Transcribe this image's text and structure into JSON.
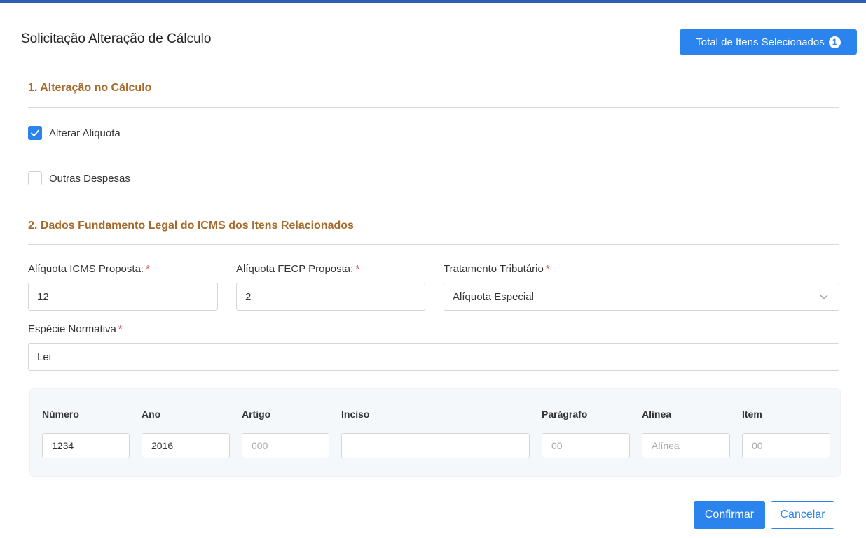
{
  "header": {
    "title": "Solicitação Alteração de Cálculo",
    "total_label": "Total de Itens Selecionados",
    "total_count": "1"
  },
  "section1": {
    "title": "1. Alteração no Cálculo",
    "options": [
      {
        "label": "Alterar Aliquota",
        "checked": true
      },
      {
        "label": "Outras Despesas",
        "checked": false
      }
    ]
  },
  "section2": {
    "title": "2. Dados Fundamento Legal do ICMS dos Itens Relacionados",
    "aliquota_icms": {
      "label": "Alíquota ICMS Proposta:",
      "value": "12"
    },
    "aliquota_fecp": {
      "label": "Alíquota FECP Proposta:",
      "value": "2"
    },
    "tratamento": {
      "label": "Tratamento Tributário",
      "value": "Alíquota Especial"
    },
    "especie": {
      "label": "Espécie Normativa",
      "value": "Lei"
    },
    "required_mark": "*"
  },
  "legal_table": {
    "columns": [
      {
        "label": "Número",
        "value": "1234",
        "placeholder": ""
      },
      {
        "label": "Ano",
        "value": "2016",
        "placeholder": ""
      },
      {
        "label": "Artigo",
        "value": "",
        "placeholder": "000"
      },
      {
        "label": "Inciso",
        "value": "",
        "placeholder": ""
      },
      {
        "label": "Parágrafo",
        "value": "",
        "placeholder": "00"
      },
      {
        "label": "Alínea",
        "value": "",
        "placeholder": "Alínea"
      },
      {
        "label": "Item",
        "value": "",
        "placeholder": "00"
      }
    ]
  },
  "actions": {
    "confirm": "Confirmar",
    "cancel": "Cancelar"
  },
  "icons": {
    "checkbox_checked": "check-icon",
    "select_arrow": "chevron-down-icon"
  },
  "colors": {
    "primary": "#2b83ee",
    "section_title": "#a76a2a",
    "required": "#e04040"
  }
}
